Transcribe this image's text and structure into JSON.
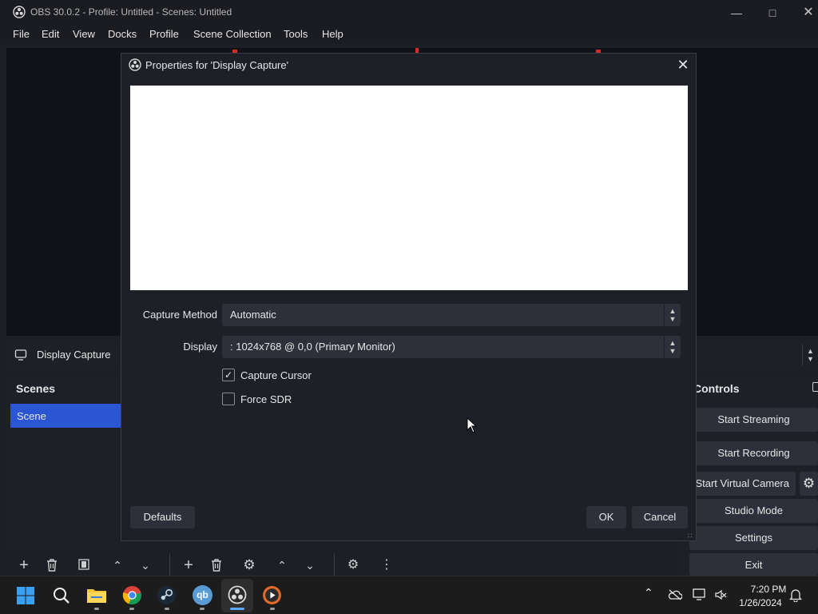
{
  "window": {
    "title": "OBS 30.0.2 - Profile: Untitled - Scenes: Untitled"
  },
  "menu": [
    "File",
    "Edit",
    "View",
    "Docks",
    "Profile",
    "Scene Collection",
    "Tools",
    "Help"
  ],
  "source": {
    "name": "Display Capture"
  },
  "scenes": {
    "header": "Scenes",
    "items": [
      "Scene"
    ]
  },
  "controls": {
    "header": "Controls",
    "start_streaming": "Start Streaming",
    "start_recording": "Start Recording",
    "start_virtual_camera": "Start Virtual Camera",
    "studio_mode": "Studio Mode",
    "settings": "Settings",
    "exit": "Exit"
  },
  "dialog": {
    "title": "Properties for 'Display Capture'",
    "capture_method_label": "Capture Method",
    "capture_method_value": "Automatic",
    "display_label": "Display",
    "display_value": ": 1024x768 @ 0,0 (Primary Monitor)",
    "capture_cursor_label": "Capture Cursor",
    "capture_cursor_checked": true,
    "force_sdr_label": "Force SDR",
    "force_sdr_checked": false,
    "defaults_label": "Defaults",
    "ok_label": "OK",
    "cancel_label": "Cancel"
  },
  "taskbar": {
    "time": "7:20 PM",
    "date": "1/26/2024"
  },
  "colors": {
    "accent": "#2a56d4",
    "dialog_bg": "#1e2028",
    "button_bg": "#2d303b"
  }
}
